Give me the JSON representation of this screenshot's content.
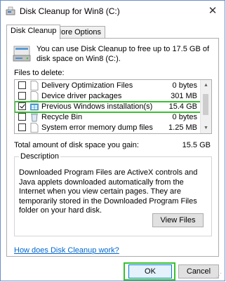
{
  "window": {
    "title": "Disk Cleanup for Win8 (C:)",
    "close_glyph": "✕"
  },
  "tabs": [
    {
      "label": "Disk Cleanup",
      "active": true
    },
    {
      "label": "More Options",
      "active": false
    }
  ],
  "intro_text": "You can use Disk Cleanup to free up to 17.5 GB of disk space on Win8 (C:).",
  "files_label": "Files to delete:",
  "files": [
    {
      "name": "Delivery Optimization Files",
      "size": "0 bytes",
      "checked": false,
      "icon": "file-icon"
    },
    {
      "name": "Device driver packages",
      "size": "301 MB",
      "checked": false,
      "icon": "file-icon"
    },
    {
      "name": "Previous Windows installation(s)",
      "size": "15.4 GB",
      "checked": true,
      "icon": "windows-install-icon"
    },
    {
      "name": "Recycle Bin",
      "size": "0 bytes",
      "checked": false,
      "icon": "recycle-bin-icon"
    },
    {
      "name": "System error memory dump files",
      "size": "1.25 MB",
      "checked": false,
      "icon": "file-icon"
    }
  ],
  "total": {
    "label": "Total amount of disk space you gain:",
    "value": "15.5 GB"
  },
  "description": {
    "legend": "Description",
    "text": "Downloaded Program Files are ActiveX controls and Java applets downloaded automatically from the Internet when you view certain pages. They are temporarily stored in the Downloaded Program Files folder on your hard disk."
  },
  "buttons": {
    "view_files": "View Files",
    "ok": "OK",
    "cancel": "Cancel"
  },
  "link": "How does Disk Cleanup work?",
  "colors": {
    "highlight": "#36c130",
    "link": "#0066cc",
    "default_button_border": "#0078d7"
  }
}
